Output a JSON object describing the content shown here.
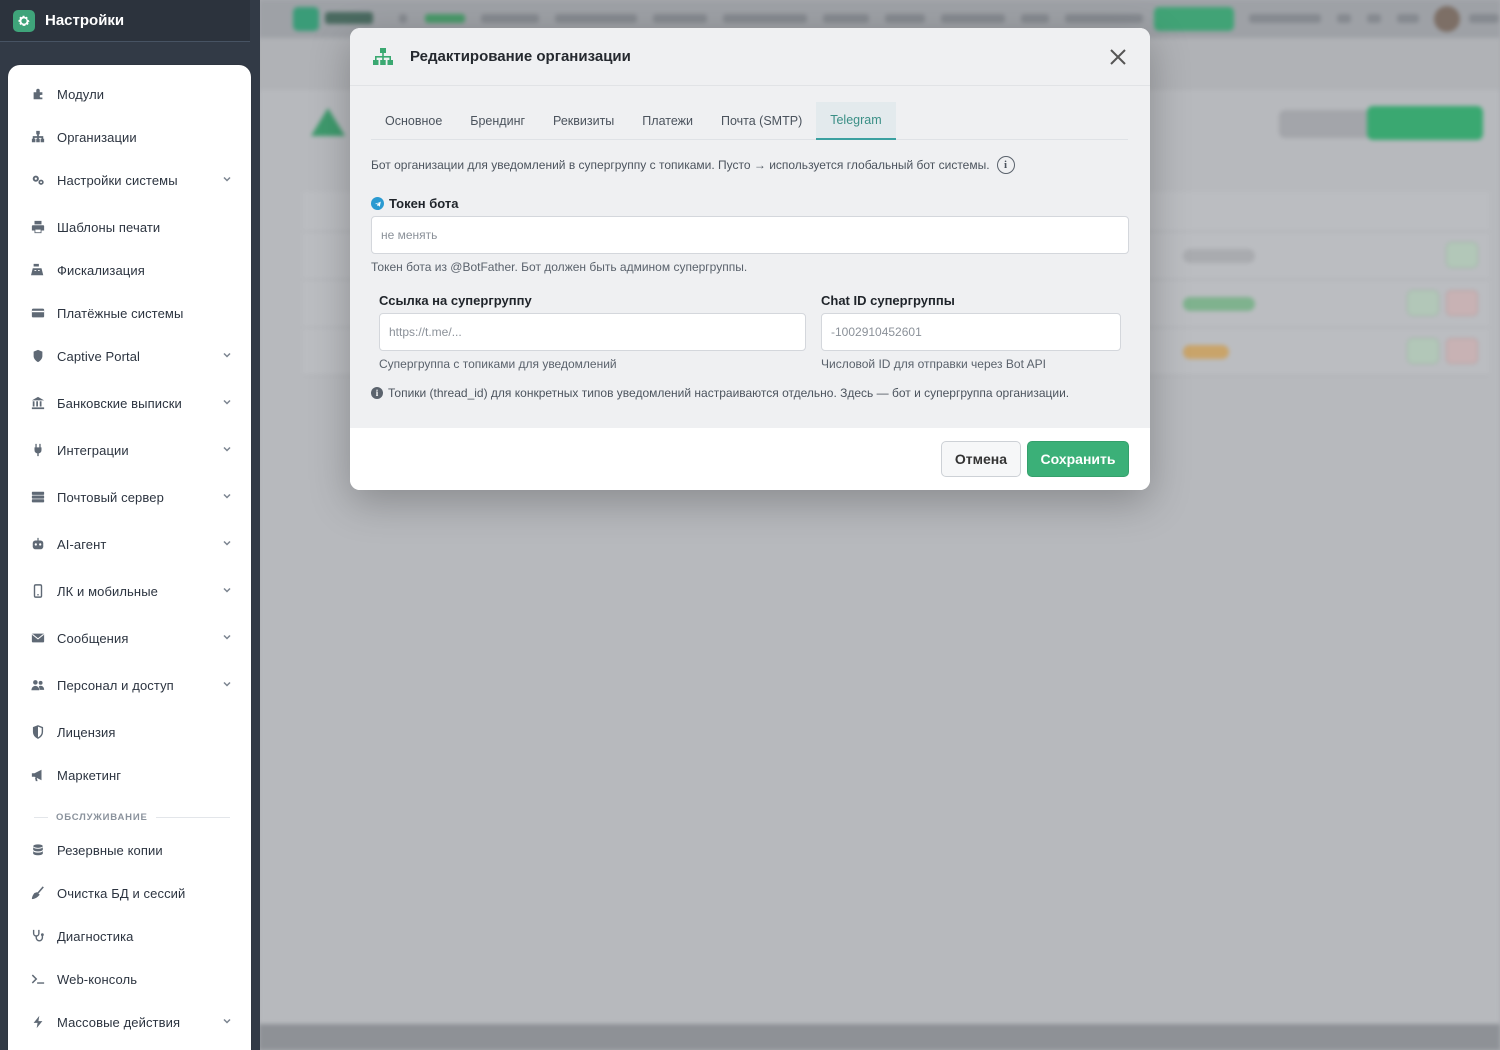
{
  "app": {
    "title": "Настройки"
  },
  "sidebar": {
    "items": [
      {
        "label": "Модули",
        "icon": "puzzle-icon",
        "chevron": false
      },
      {
        "label": "Организации",
        "icon": "sitemap-icon",
        "chevron": false
      },
      {
        "label": "Настройки системы",
        "icon": "gears-icon",
        "chevron": true
      },
      {
        "label": "Шаблоны печати",
        "icon": "printer-icon",
        "chevron": false
      },
      {
        "label": "Фискализация",
        "icon": "cash-register-icon",
        "chevron": false
      },
      {
        "label": "Платёжные системы",
        "icon": "credit-card-icon",
        "chevron": false
      },
      {
        "label": "Captive Portal",
        "icon": "shield-icon",
        "chevron": true
      },
      {
        "label": "Банковские выписки",
        "icon": "bank-icon",
        "chevron": true
      },
      {
        "label": "Интеграции",
        "icon": "plug-icon",
        "chevron": true
      },
      {
        "label": "Почтовый сервер",
        "icon": "server-icon",
        "chevron": true
      },
      {
        "label": "AI-агент",
        "icon": "robot-icon",
        "chevron": true
      },
      {
        "label": "ЛК и мобильные",
        "icon": "mobile-icon",
        "chevron": true
      },
      {
        "label": "Сообщения",
        "icon": "envelope-icon",
        "chevron": true
      },
      {
        "label": "Персонал и доступ",
        "icon": "users-icon",
        "chevron": true
      },
      {
        "label": "Лицензия",
        "icon": "shield-half-icon",
        "chevron": false
      },
      {
        "label": "Маркетинг",
        "icon": "megaphone-icon",
        "chevron": false
      },
      {
        "label": "Резервные копии",
        "icon": "database-icon",
        "chevron": false
      },
      {
        "label": "Очистка БД и сессий",
        "icon": "broom-icon",
        "chevron": false
      },
      {
        "label": "Диагностика",
        "icon": "stethoscope-icon",
        "chevron": false
      },
      {
        "label": "Web-консоль",
        "icon": "terminal-icon",
        "chevron": false
      },
      {
        "label": "Массовые действия",
        "icon": "bolt-icon",
        "chevron": true
      }
    ],
    "section_label": "ОБСЛУЖИВАНИЕ"
  },
  "modal": {
    "title": "Редактирование организации",
    "tabs": [
      {
        "label": "Основное",
        "active": false
      },
      {
        "label": "Брендинг",
        "active": false
      },
      {
        "label": "Реквизиты",
        "active": false
      },
      {
        "label": "Платежи",
        "active": false
      },
      {
        "label": "Почта (SMTP)",
        "active": false
      },
      {
        "label": "Telegram",
        "active": true
      }
    ],
    "description": "Бот организации для уведомлений в супергруппу с топиками. Пусто → используется глобальный бот системы.",
    "token": {
      "label": "Токен бота",
      "placeholder": "не менять",
      "hint": "Токен бота из @BotFather. Бот должен быть админом супергруппы."
    },
    "group_link": {
      "label": "Ссылка на супергруппу",
      "placeholder": "https://t.me/...",
      "hint": "Супергруппа с топиками для уведомлений"
    },
    "chat_id": {
      "label": "Chat ID супергруппы",
      "placeholder": "-1002910452601",
      "hint": "Числовой ID для отправки через Bot API"
    },
    "note": "Топики (thread_id) для конкретных типов уведомлений настраиваются отдельно. Здесь — бот и супергруппа организации.",
    "cancel_label": "Отмена",
    "save_label": "Сохранить"
  },
  "colors": {
    "accent": "#3bb078",
    "sidebar_bg": "#323a46",
    "tab_active": "#3a8f86"
  }
}
